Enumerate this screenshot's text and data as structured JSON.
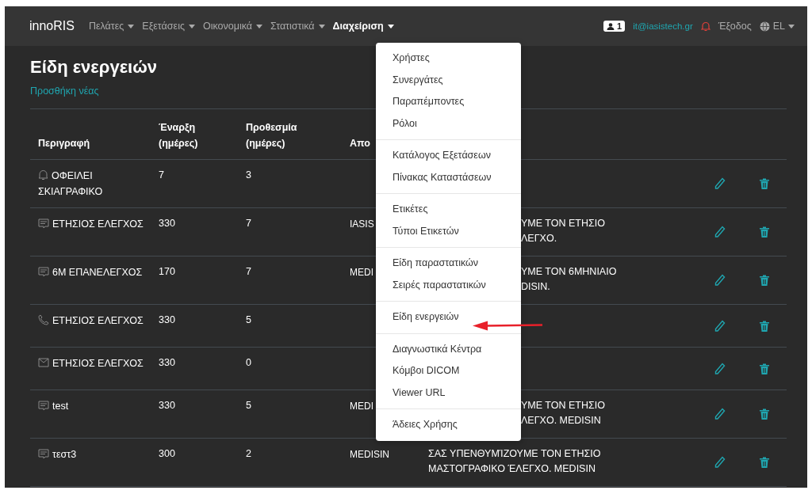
{
  "navbar": {
    "brand": "innoRIS",
    "items": [
      {
        "label": "Πελάτες",
        "expanded": false
      },
      {
        "label": "Εξετάσεις",
        "expanded": false
      },
      {
        "label": "Οικονομικά",
        "expanded": false
      },
      {
        "label": "Στατιστικά",
        "expanded": false
      },
      {
        "label": "Διαχείριση",
        "expanded": true
      }
    ],
    "user_count": "1",
    "email": "it@iasistech.gr",
    "logout": "Έξοδος",
    "language": "EL"
  },
  "page": {
    "title": "Είδη ενεργειών",
    "add_link": "Προσθήκη νέας"
  },
  "table": {
    "columns": [
      "Περιγραφή",
      "Έναρξη (ημέρες)",
      "Προθεσμία (ημέρες)",
      "Απο"
    ],
    "rows": [
      {
        "kind": "bell",
        "description": "ΟΦΕΙΛΕΙ ΣΚΙΑΓΡΑΦΙΚΟ",
        "start": "7",
        "deadline": "3"
      },
      {
        "kind": "message",
        "description": "ΕΤΗΣΙΟΣ ΕΛΕΓΧΟΣ",
        "start": "330",
        "deadline": "7",
        "column_4": "IASIS",
        "message": [
          "ΥΜΕ ΤΟΝ ΕΤΗΣΙΟ",
          "ΛΕΓΧΟ."
        ]
      },
      {
        "kind": "message",
        "description": "6Μ ΕΠΑΝΕΛΕΓΧΟΣ",
        "start": "170",
        "deadline": "7",
        "column_4": "MEDI",
        "message": [
          "ΥΜΕ ΤΟΝ 6ΜΗΝΙΑΙΟ",
          "DISIN."
        ]
      },
      {
        "kind": "phone",
        "description": "ΕΤΗΣΙΟΣ ΕΛΕΓΧΟΣ",
        "start": "330",
        "deadline": "5"
      },
      {
        "kind": "mail",
        "description": "ΕΤΗΣΙΟΣ ΕΛΕΓΧΟΣ",
        "start": "330",
        "deadline": "0"
      },
      {
        "kind": "message",
        "description": "test",
        "start": "330",
        "deadline": "5",
        "column_4": "MEDI",
        "message": [
          "ΥΜΕ ΤΟΝ ΕΤΗΣΙΟ",
          "ΛΕΓΧΟ. MEDISIN"
        ]
      },
      {
        "kind": "message",
        "description": "τεστ3",
        "start": "300",
        "deadline": "2",
        "column_4": "MEDISIN",
        "message": [
          "ΣΑΣ ΥΠΕΝΘΥΜΊΖΟΥΜΕ ΤΟΝ ΕΤΗΣΙΟ ΜΑΣΤΟΓΡΑΦΙΚΟ ΈΛΕΓΧΟ. MEDISIN"
        ]
      }
    ]
  },
  "dropdown": {
    "groups": [
      [
        "Χρήστες",
        "Συνεργάτες",
        "Παραπέμποντες",
        "Ρόλοι"
      ],
      [
        "Κατάλογος Εξετάσεων",
        "Πίνακας Καταστάσεων"
      ],
      [
        "Ετικέτες",
        "Τύποι Ετικετών"
      ],
      [
        "Είδη παραστατικών",
        "Σειρές παραστατικών"
      ],
      [
        "Είδη ενεργειών"
      ],
      [
        "Διαγνωστικά Κέντρα",
        "Κόμβοι DICOM",
        "Viewer URL"
      ],
      [
        "Άδειες Χρήσης"
      ]
    ]
  }
}
